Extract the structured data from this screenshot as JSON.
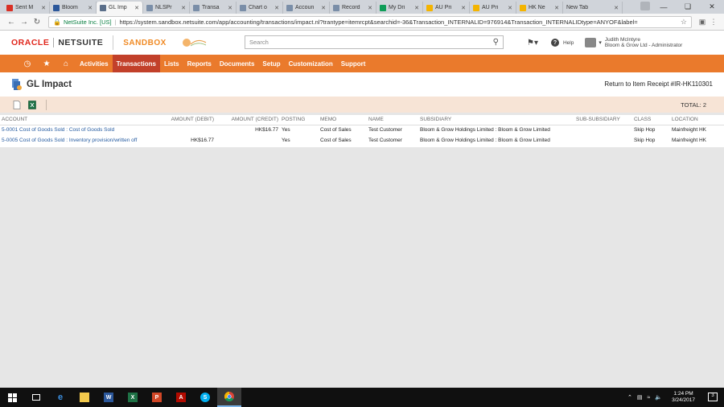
{
  "browser": {
    "tabs": [
      {
        "label": "Sent M",
        "color": "#d93025"
      },
      {
        "label": "Bloom",
        "color": "#2b579a"
      },
      {
        "label": "GL Imp",
        "color": "#5b6f8a",
        "active": true
      },
      {
        "label": "NLSPr",
        "color": "#7a8ea8"
      },
      {
        "label": "Transa",
        "color": "#7a8ea8"
      },
      {
        "label": "Chart o",
        "color": "#7a8ea8"
      },
      {
        "label": "Accoun",
        "color": "#7a8ea8"
      },
      {
        "label": "Record",
        "color": "#7a8ea8"
      },
      {
        "label": "My Dri",
        "color": "#0f9d58"
      },
      {
        "label": "AU Pri",
        "color": "#f4b400"
      },
      {
        "label": "AU Pri",
        "color": "#f4b400"
      },
      {
        "label": "HK Ne",
        "color": "#f4b400"
      },
      {
        "label": "New Tab",
        "color": ""
      }
    ],
    "secure_label": "NetSuite Inc. [US]",
    "url": "https://system.sandbox.netsuite.com/app/accounting/transactions/impact.nl?trantype=itemrcpt&searchid=-36&Transaction_INTERNALID=976914&Transaction_INTERNALIDtype=ANYOF&label="
  },
  "header": {
    "oracle": "ORACLE",
    "netsuite": "NETSUITE",
    "sandbox": "SANDBOX",
    "search_placeholder": "Search",
    "help": "Help",
    "user_name": "Judith McIntyre",
    "user_role": "Bloom & Grow Ltd - Administrator"
  },
  "nav": {
    "items": [
      "Activities",
      "Transactions",
      "Lists",
      "Reports",
      "Documents",
      "Setup",
      "Customization",
      "Support"
    ],
    "active": "Transactions"
  },
  "page": {
    "title": "GL Impact",
    "return_link": "Return to Item Receipt #IR-HK110301",
    "total": "TOTAL: 2"
  },
  "table": {
    "columns": [
      "ACCOUNT",
      "AMOUNT (DEBIT)",
      "AMOUNT (CREDIT)",
      "POSTING",
      "MEMO",
      "NAME",
      "SUBSIDIARY",
      "SUB-SUBSIDIARY",
      "CLASS",
      "LOCATION"
    ],
    "rows": [
      {
        "account": "5-0001 Cost of Goods Sold : Cost of Goods Sold",
        "debit": "",
        "credit": "HK$16.77",
        "posting": "Yes",
        "memo": "Cost of Sales",
        "name": "Test Customer",
        "subsidiary": "Bloom & Grow Holdings Limited : Bloom & Grow Limited",
        "subsub": "",
        "class": "Skip Hop",
        "location": "Mainfreight HK"
      },
      {
        "account": "5-0005 Cost of Goods Sold : Inventory provision/written off",
        "debit": "HK$16.77",
        "credit": "",
        "posting": "Yes",
        "memo": "Cost of Sales",
        "name": "Test Customer",
        "subsidiary": "Bloom & Grow Holdings Limited : Bloom & Grow Limited",
        "subsub": "",
        "class": "Skip Hop",
        "location": "Mainfreight HK"
      }
    ]
  },
  "taskbar": {
    "time": "1:24 PM",
    "date": "3/24/2017",
    "notif_count": "3"
  }
}
